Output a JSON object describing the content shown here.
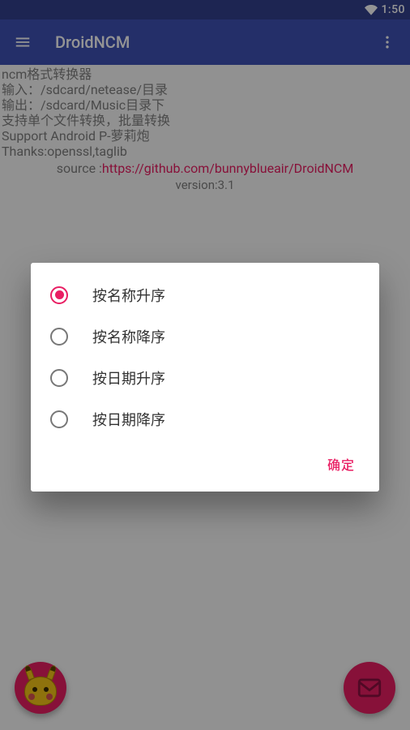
{
  "statusbar": {
    "time": "1:50"
  },
  "appbar": {
    "title": "DroidNCM"
  },
  "body": {
    "lines": [
      "ncm格式转换器",
      "输入：/sdcard/netease/目录",
      "输出：/sdcard/Music目录下",
      "支持单个文件转换，批量转换",
      "Support Android P-萝莉炮",
      "Thanks:openssl,taglib"
    ],
    "source_prefix": "source :",
    "source_url": "https://github.com/bunnyblueair/DroidNCM",
    "version": "version:3.1"
  },
  "dialog": {
    "options": [
      {
        "label": "按名称升序",
        "selected": true
      },
      {
        "label": "按名称降序",
        "selected": false
      },
      {
        "label": "按日期升序",
        "selected": false
      },
      {
        "label": "按日期降序",
        "selected": false
      }
    ],
    "confirm": "确定"
  },
  "colors": {
    "primary": "#3f51b5",
    "primary_dark": "#32408e",
    "accent": "#e91e63"
  }
}
